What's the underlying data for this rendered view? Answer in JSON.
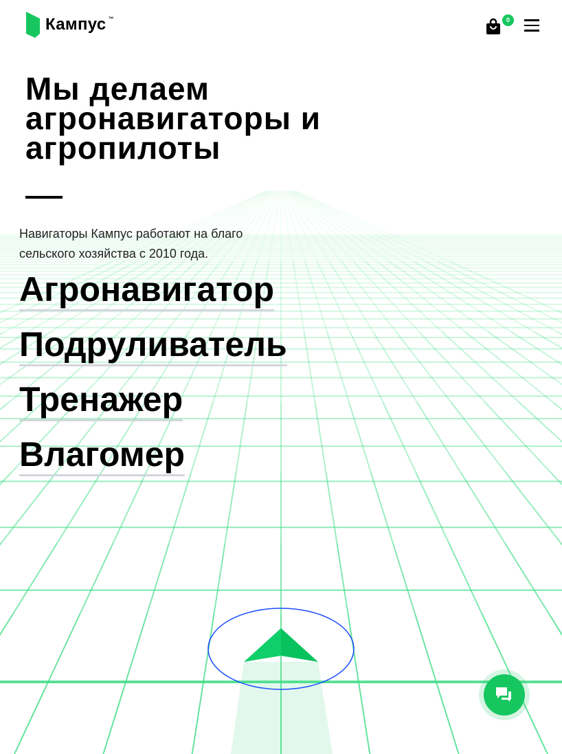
{
  "header": {
    "logo_text": "Кампус",
    "logo_tm": "™",
    "cart_count": "0"
  },
  "hero": {
    "title": "Мы делаем агронавигаторы и агропилоты",
    "lead": "Навигаторы Кампус работают на благо сельского хозяйства с 2010 года.",
    "links": [
      "Агронавигатор",
      "Подруливатель",
      "Тренажер",
      "Влагомер"
    ]
  },
  "colors": {
    "accent": "#16c75f",
    "grid": "#3ddc84",
    "ring": "#1a4dff"
  }
}
